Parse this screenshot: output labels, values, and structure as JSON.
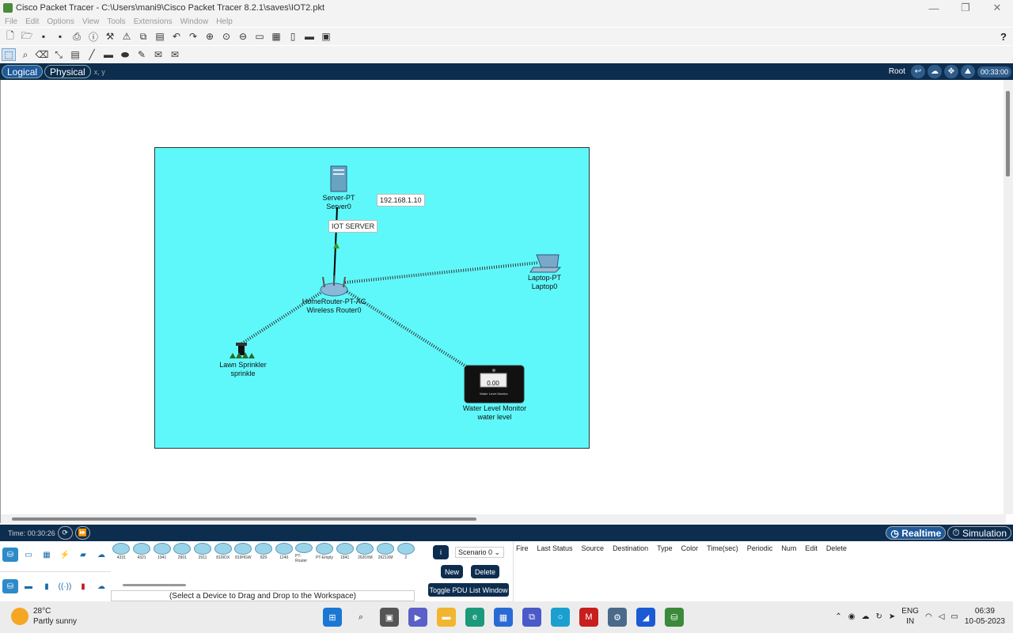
{
  "window": {
    "title": "Cisco Packet Tracer - C:\\Users\\mani9\\Cisco Packet Tracer 8.2.1\\saves\\IOT2.pkt",
    "minimize": "—",
    "restore": "❐",
    "close": "✕"
  },
  "menu": [
    "File",
    "Edit",
    "Options",
    "View",
    "Tools",
    "Extensions",
    "Window",
    "Help"
  ],
  "toolbar": {
    "help": "?"
  },
  "views": {
    "logical": "Logical",
    "physical": "Physical",
    "coords": "x, y",
    "root": "Root",
    "clock": "00:33:00"
  },
  "devices": [
    {
      "id": "server",
      "model": "Server-PT",
      "name": "Server0"
    },
    {
      "id": "router",
      "model": "HomeRouter-PT-AC",
      "name": "Wireless Router0"
    },
    {
      "id": "laptop",
      "model": "Laptop-PT",
      "name": "Laptop0"
    },
    {
      "id": "sprinkler",
      "model": "Lawn Sprinkler",
      "name": "sprinkle"
    },
    {
      "id": "water",
      "model": "Water Level Monitor",
      "name": "water level",
      "screen_value": "0.00",
      "screen_caption": "Water Level Monitor"
    }
  ],
  "notes": {
    "ip": "192.168.1.10",
    "server_note": "IOT SERVER"
  },
  "statusbar": {
    "time": "Time: 00:30:26",
    "realtime": "Realtime",
    "simulation": "Simulation"
  },
  "device_panel": {
    "models": [
      "4331",
      "4321",
      "1941",
      "2901",
      "2911",
      "819IOX",
      "819HGW",
      "829",
      "1240",
      "PT-Router",
      "PT-Empty",
      "1841",
      "2620XM",
      "2621XM",
      "2"
    ],
    "hint": "(Select a Device to Drag and Drop to the Workspace)"
  },
  "pdu": {
    "info": "i",
    "scenario": "Scenario 0",
    "new": "New",
    "delete": "Delete",
    "toggle": "Toggle PDU List Window",
    "columns": [
      "Fire",
      "Last Status",
      "Source",
      "Destination",
      "Type",
      "Color",
      "Time(sec)",
      "Periodic",
      "Num",
      "Edit",
      "Delete"
    ]
  },
  "taskbar": {
    "temp": "28°C",
    "weather": "Partly sunny",
    "lang1": "ENG",
    "lang2": "IN",
    "time": "06:39",
    "date": "10-05-2023"
  },
  "colors": {
    "cluster_bg": "#5ff8fa",
    "navy": "#0d2d4f"
  }
}
